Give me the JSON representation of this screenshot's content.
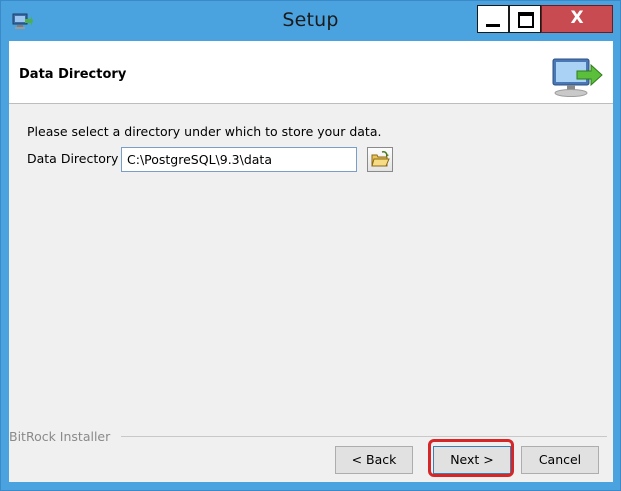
{
  "window": {
    "title": "Setup",
    "close_glyph": "X",
    "accent_color": "#4aa3df",
    "icons": [
      "app-icon",
      "minimize-icon",
      "maximize-icon",
      "close-icon",
      "computer-arrow-icon",
      "folder-open-icon"
    ]
  },
  "header": {
    "title": "Data Directory"
  },
  "content": {
    "instruction": "Please select a directory under which to store your data.",
    "data_directory_label": "Data Directory",
    "data_directory_value": "C:\\PostgreSQL\\9.3\\data"
  },
  "footer": {
    "installer_label": "BitRock Installer",
    "back_label": "< Back",
    "next_label": "Next >",
    "cancel_label": "Cancel",
    "highlight_color": "#d62728"
  }
}
